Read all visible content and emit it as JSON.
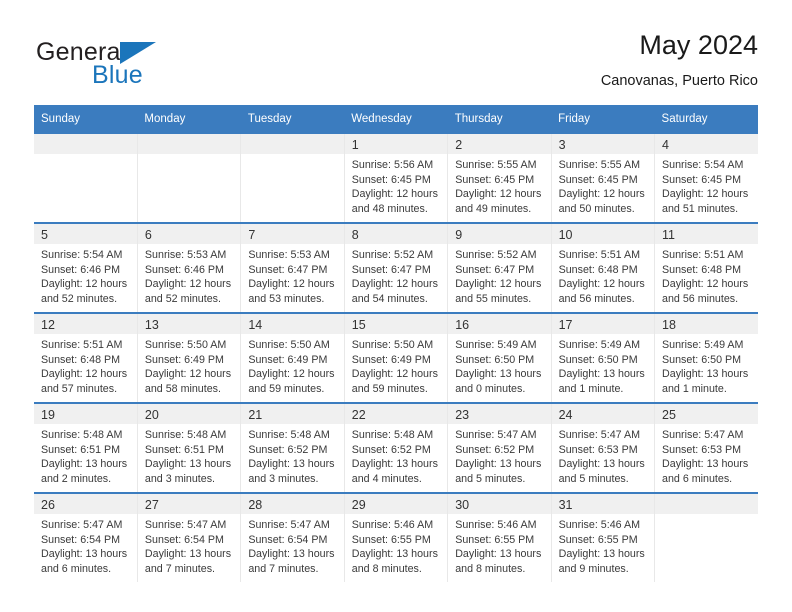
{
  "brand": {
    "word_one": "General",
    "word_two": "Blue",
    "accent_color": "#1b75bb",
    "triangle_icon": "brand-triangle-icon"
  },
  "header": {
    "title": "May 2024",
    "subtitle": "Canovanas, Puerto Rico"
  },
  "theme": {
    "header_blue": "#3b7cbf",
    "band_gray": "#f0f0f0",
    "text": "#3a3a3a"
  },
  "calendar": {
    "weekday_headers": [
      "Sunday",
      "Monday",
      "Tuesday",
      "Wednesday",
      "Thursday",
      "Friday",
      "Saturday"
    ],
    "weeks": [
      [
        {
          "day": "",
          "empty": true,
          "lines": []
        },
        {
          "day": "",
          "empty": true,
          "lines": []
        },
        {
          "day": "",
          "empty": true,
          "lines": []
        },
        {
          "day": "1",
          "empty": false,
          "lines": [
            "Sunrise: 5:56 AM",
            "Sunset: 6:45 PM",
            "Daylight: 12 hours",
            "and 48 minutes."
          ]
        },
        {
          "day": "2",
          "empty": false,
          "lines": [
            "Sunrise: 5:55 AM",
            "Sunset: 6:45 PM",
            "Daylight: 12 hours",
            "and 49 minutes."
          ]
        },
        {
          "day": "3",
          "empty": false,
          "lines": [
            "Sunrise: 5:55 AM",
            "Sunset: 6:45 PM",
            "Daylight: 12 hours",
            "and 50 minutes."
          ]
        },
        {
          "day": "4",
          "empty": false,
          "lines": [
            "Sunrise: 5:54 AM",
            "Sunset: 6:45 PM",
            "Daylight: 12 hours",
            "and 51 minutes."
          ]
        }
      ],
      [
        {
          "day": "5",
          "empty": false,
          "lines": [
            "Sunrise: 5:54 AM",
            "Sunset: 6:46 PM",
            "Daylight: 12 hours",
            "and 52 minutes."
          ]
        },
        {
          "day": "6",
          "empty": false,
          "lines": [
            "Sunrise: 5:53 AM",
            "Sunset: 6:46 PM",
            "Daylight: 12 hours",
            "and 52 minutes."
          ]
        },
        {
          "day": "7",
          "empty": false,
          "lines": [
            "Sunrise: 5:53 AM",
            "Sunset: 6:47 PM",
            "Daylight: 12 hours",
            "and 53 minutes."
          ]
        },
        {
          "day": "8",
          "empty": false,
          "lines": [
            "Sunrise: 5:52 AM",
            "Sunset: 6:47 PM",
            "Daylight: 12 hours",
            "and 54 minutes."
          ]
        },
        {
          "day": "9",
          "empty": false,
          "lines": [
            "Sunrise: 5:52 AM",
            "Sunset: 6:47 PM",
            "Daylight: 12 hours",
            "and 55 minutes."
          ]
        },
        {
          "day": "10",
          "empty": false,
          "lines": [
            "Sunrise: 5:51 AM",
            "Sunset: 6:48 PM",
            "Daylight: 12 hours",
            "and 56 minutes."
          ]
        },
        {
          "day": "11",
          "empty": false,
          "lines": [
            "Sunrise: 5:51 AM",
            "Sunset: 6:48 PM",
            "Daylight: 12 hours",
            "and 56 minutes."
          ]
        }
      ],
      [
        {
          "day": "12",
          "empty": false,
          "lines": [
            "Sunrise: 5:51 AM",
            "Sunset: 6:48 PM",
            "Daylight: 12 hours",
            "and 57 minutes."
          ]
        },
        {
          "day": "13",
          "empty": false,
          "lines": [
            "Sunrise: 5:50 AM",
            "Sunset: 6:49 PM",
            "Daylight: 12 hours",
            "and 58 minutes."
          ]
        },
        {
          "day": "14",
          "empty": false,
          "lines": [
            "Sunrise: 5:50 AM",
            "Sunset: 6:49 PM",
            "Daylight: 12 hours",
            "and 59 minutes."
          ]
        },
        {
          "day": "15",
          "empty": false,
          "lines": [
            "Sunrise: 5:50 AM",
            "Sunset: 6:49 PM",
            "Daylight: 12 hours",
            "and 59 minutes."
          ]
        },
        {
          "day": "16",
          "empty": false,
          "lines": [
            "Sunrise: 5:49 AM",
            "Sunset: 6:50 PM",
            "Daylight: 13 hours",
            "and 0 minutes."
          ]
        },
        {
          "day": "17",
          "empty": false,
          "lines": [
            "Sunrise: 5:49 AM",
            "Sunset: 6:50 PM",
            "Daylight: 13 hours",
            "and 1 minute."
          ]
        },
        {
          "day": "18",
          "empty": false,
          "lines": [
            "Sunrise: 5:49 AM",
            "Sunset: 6:50 PM",
            "Daylight: 13 hours",
            "and 1 minute."
          ]
        }
      ],
      [
        {
          "day": "19",
          "empty": false,
          "lines": [
            "Sunrise: 5:48 AM",
            "Sunset: 6:51 PM",
            "Daylight: 13 hours",
            "and 2 minutes."
          ]
        },
        {
          "day": "20",
          "empty": false,
          "lines": [
            "Sunrise: 5:48 AM",
            "Sunset: 6:51 PM",
            "Daylight: 13 hours",
            "and 3 minutes."
          ]
        },
        {
          "day": "21",
          "empty": false,
          "lines": [
            "Sunrise: 5:48 AM",
            "Sunset: 6:52 PM",
            "Daylight: 13 hours",
            "and 3 minutes."
          ]
        },
        {
          "day": "22",
          "empty": false,
          "lines": [
            "Sunrise: 5:48 AM",
            "Sunset: 6:52 PM",
            "Daylight: 13 hours",
            "and 4 minutes."
          ]
        },
        {
          "day": "23",
          "empty": false,
          "lines": [
            "Sunrise: 5:47 AM",
            "Sunset: 6:52 PM",
            "Daylight: 13 hours",
            "and 5 minutes."
          ]
        },
        {
          "day": "24",
          "empty": false,
          "lines": [
            "Sunrise: 5:47 AM",
            "Sunset: 6:53 PM",
            "Daylight: 13 hours",
            "and 5 minutes."
          ]
        },
        {
          "day": "25",
          "empty": false,
          "lines": [
            "Sunrise: 5:47 AM",
            "Sunset: 6:53 PM",
            "Daylight: 13 hours",
            "and 6 minutes."
          ]
        }
      ],
      [
        {
          "day": "26",
          "empty": false,
          "lines": [
            "Sunrise: 5:47 AM",
            "Sunset: 6:54 PM",
            "Daylight: 13 hours",
            "and 6 minutes."
          ]
        },
        {
          "day": "27",
          "empty": false,
          "lines": [
            "Sunrise: 5:47 AM",
            "Sunset: 6:54 PM",
            "Daylight: 13 hours",
            "and 7 minutes."
          ]
        },
        {
          "day": "28",
          "empty": false,
          "lines": [
            "Sunrise: 5:47 AM",
            "Sunset: 6:54 PM",
            "Daylight: 13 hours",
            "and 7 minutes."
          ]
        },
        {
          "day": "29",
          "empty": false,
          "lines": [
            "Sunrise: 5:46 AM",
            "Sunset: 6:55 PM",
            "Daylight: 13 hours",
            "and 8 minutes."
          ]
        },
        {
          "day": "30",
          "empty": false,
          "lines": [
            "Sunrise: 5:46 AM",
            "Sunset: 6:55 PM",
            "Daylight: 13 hours",
            "and 8 minutes."
          ]
        },
        {
          "day": "31",
          "empty": false,
          "lines": [
            "Sunrise: 5:46 AM",
            "Sunset: 6:55 PM",
            "Daylight: 13 hours",
            "and 9 minutes."
          ]
        },
        {
          "day": "",
          "empty": true,
          "lines": []
        }
      ]
    ]
  }
}
